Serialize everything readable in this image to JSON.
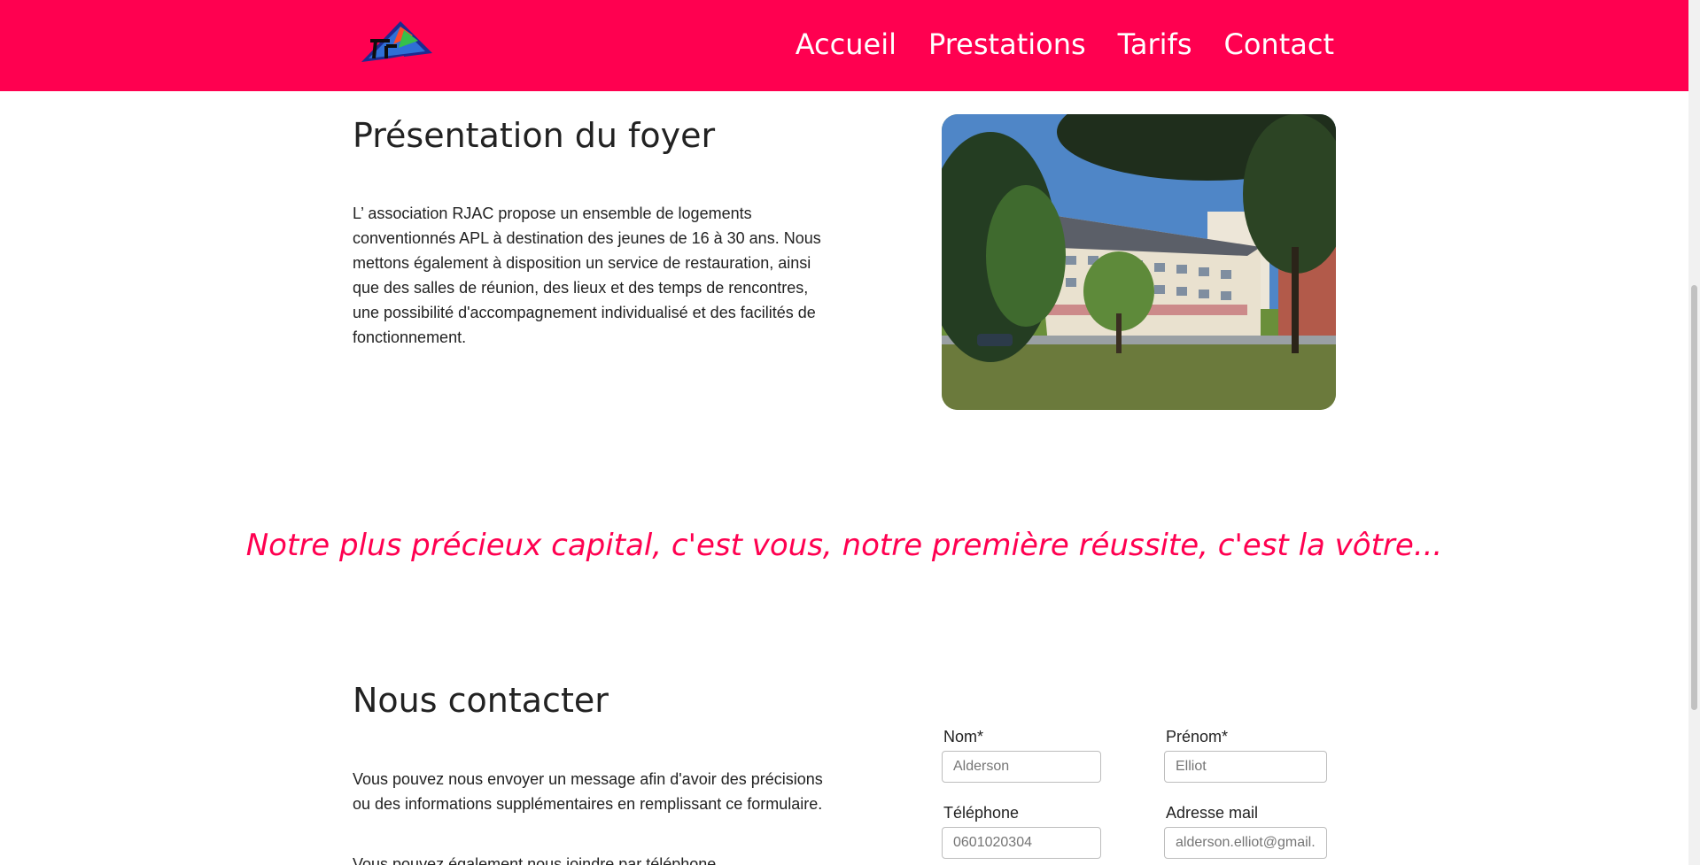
{
  "header": {
    "brand_color": "#ff0050",
    "logo_icon": "triangle-logo",
    "nav": [
      {
        "label": "Accueil"
      },
      {
        "label": "Prestations"
      },
      {
        "label": "Tarifs"
      },
      {
        "label": "Contact"
      }
    ]
  },
  "presentation": {
    "title": "Présentation du foyer",
    "text": "L’ association RJAC propose un ensemble de logements conventionnés APL à destination des jeunes de 16 à 30 ans. Nous mettons également à disposition un service de restauration, ainsi que des salles de réunion, des lieux et des temps de rencontres, une possibilité d'accompagnement individualisé et des facilités de fonctionnement."
  },
  "quote": {
    "text": "Notre plus précieux capital, c'est vous, notre première réussite, c'est la vôtre..."
  },
  "contact": {
    "title": "Nous contacter",
    "text": "Vous pouvez nous envoyer un message afin d'avoir des précisions ou des informations supplémentaires en remplissant ce formulaire.",
    "text_cut": "Vous pouvez également nous joindre par téléphone",
    "form": {
      "nom_label": "Nom*",
      "nom_placeholder": "Alderson",
      "prenom_label": "Prénom*",
      "prenom_placeholder": "Elliot",
      "tel_label": "Téléphone",
      "tel_placeholder": "0601020304",
      "mail_label": "Adresse mail",
      "mail_placeholder": "alderson.elliot@gmail.com"
    }
  }
}
